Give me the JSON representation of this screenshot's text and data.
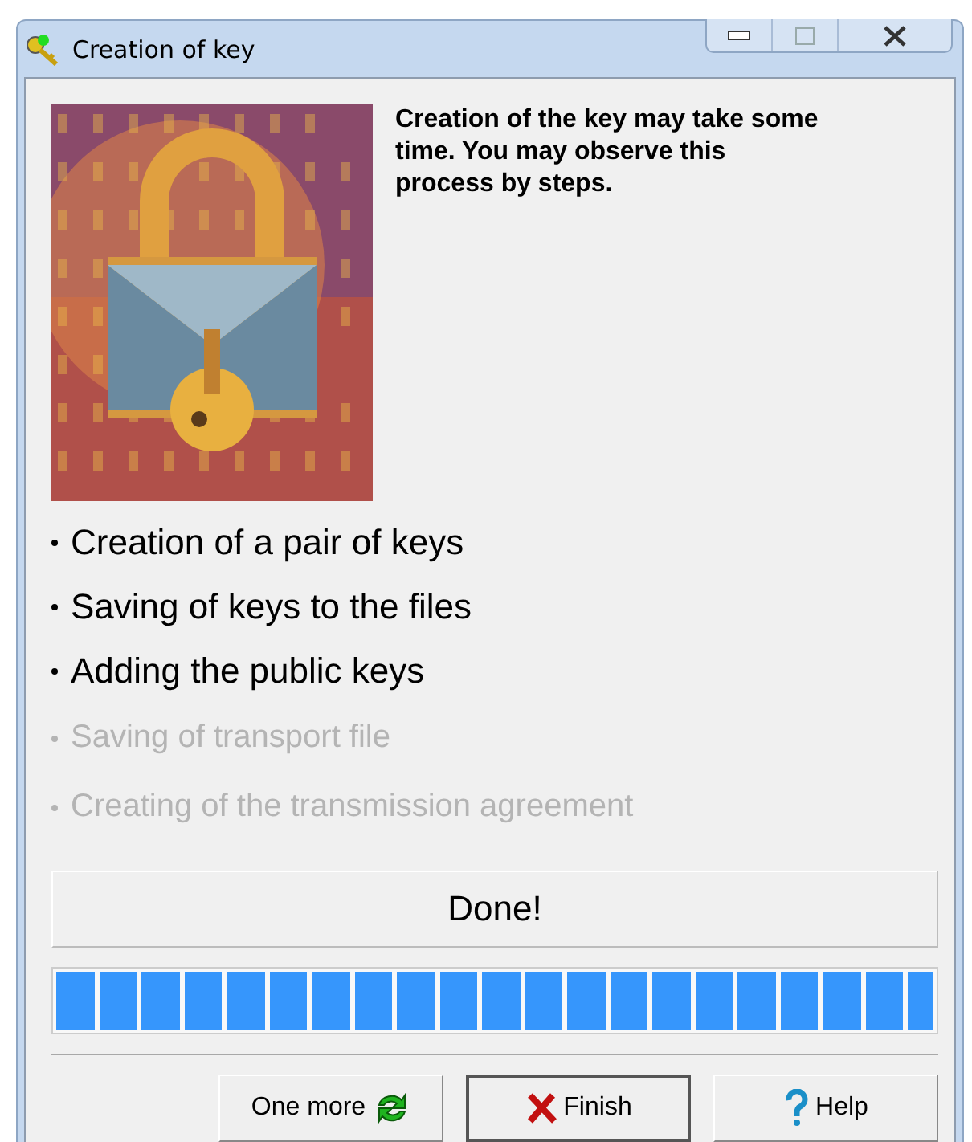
{
  "window": {
    "title": "Creation of key"
  },
  "intro": "Creation of the key may take some time. You may observe this process by steps.",
  "steps": [
    {
      "label": "Creation of a pair of keys",
      "done": true
    },
    {
      "label": "Saving of keys to the files",
      "done": true
    },
    {
      "label": "Adding the public keys",
      "done": true
    },
    {
      "label": "Saving of transport file",
      "done": false
    },
    {
      "label": "Creating of the transmission agreement",
      "done": false
    }
  ],
  "status": "Done!",
  "progress": {
    "level": 1
  },
  "buttons": [
    {
      "label": "One more",
      "kind": "repeat"
    },
    {
      "label": "Finish",
      "kind": "finish",
      "selected": true
    },
    {
      "label": "Help",
      "kind": "help",
      "selected": false
    }
  ]
}
